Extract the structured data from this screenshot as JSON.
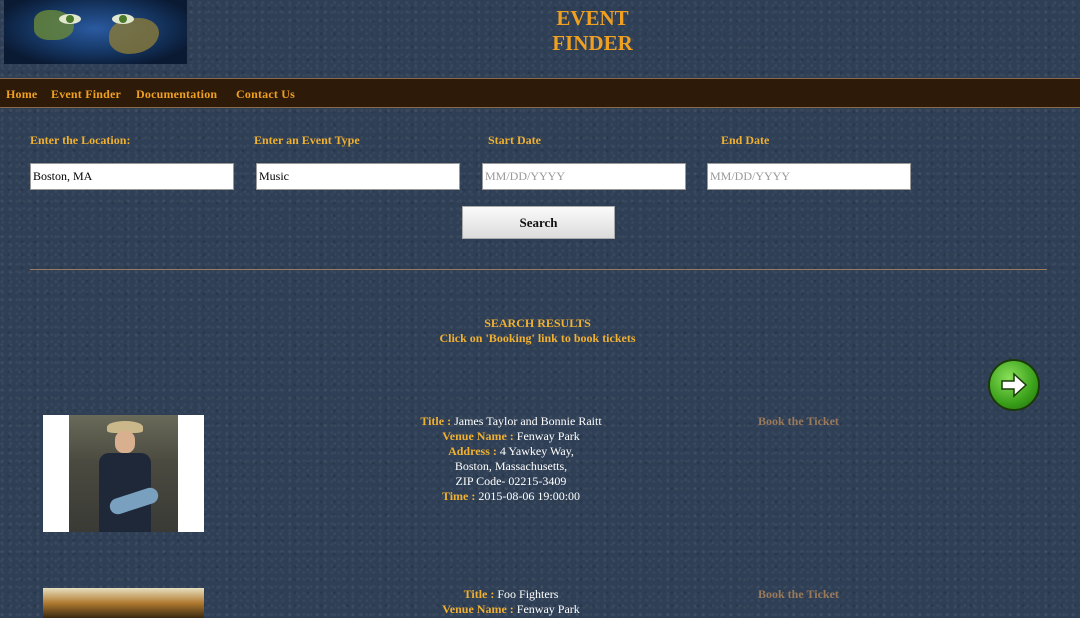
{
  "header": {
    "title_line1": "EVENT",
    "title_line2": "FINDER"
  },
  "nav": {
    "items": [
      "Home",
      "Event Finder",
      "Documentation",
      "Contact Us"
    ]
  },
  "form": {
    "location": {
      "label": "Enter the Location:",
      "value": "Boston, MA"
    },
    "event_type": {
      "label": "Enter an Event Type",
      "value": "Music"
    },
    "start_date": {
      "label": "Start Date",
      "placeholder": "MM/DD/YYYY"
    },
    "end_date": {
      "label": "End Date",
      "placeholder": "MM/DD/YYYY"
    },
    "search_label": "Search"
  },
  "results": {
    "heading": "SEARCH RESULTS",
    "subheading": "Click on 'Booking' link to book tickets",
    "next_icon": "right-arrow-icon",
    "events": [
      {
        "title_key": "Title :",
        "title": "James Taylor and Bonnie Raitt",
        "venue_key": "Venue Name :",
        "venue": "Fenway Park",
        "address_key": "Address :",
        "address_line1": "4 Yawkey Way,",
        "address_line2": "Boston, Massachusetts,",
        "address_line3": "ZIP Code- 02215-3409",
        "time_key": "Time :",
        "time": "2015-08-06 19:00:00",
        "book_label": "Book the Ticket"
      },
      {
        "title_key": "Title :",
        "title": "Foo Fighters",
        "venue_key": "Venue Name :",
        "venue": "Fenway Park",
        "book_label": "Book the Ticket"
      }
    ]
  },
  "colors": {
    "accent": "#f0a020",
    "nav_bg": "#2e1a08",
    "page_bg": "#2f3f55",
    "link_muted": "#9a7a5a"
  }
}
